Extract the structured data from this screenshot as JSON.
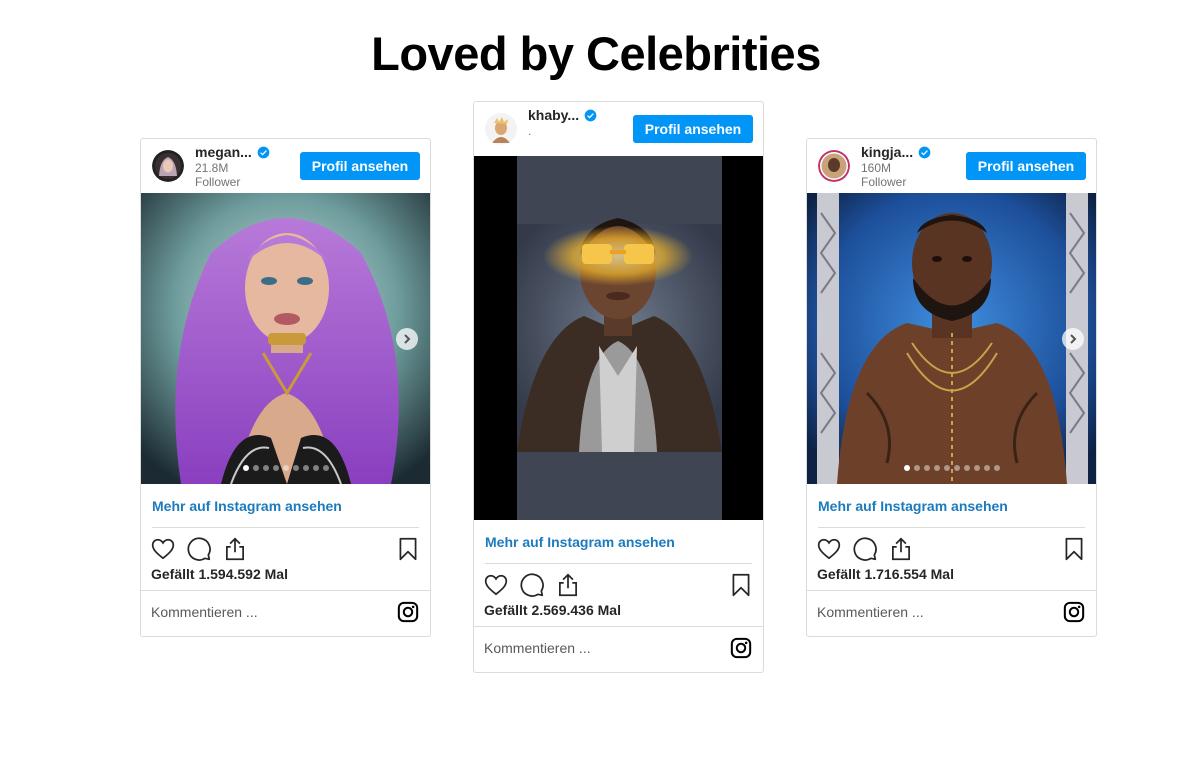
{
  "page": {
    "title": "Loved by Celebrities"
  },
  "posts": [
    {
      "username": "megan...",
      "followers": "21.8M",
      "followers_label": "Follower",
      "profile_button": "Profil ansehen",
      "more_link": "Mehr auf Instagram ansehen",
      "likes": "Gefällt 1.594.592 Mal",
      "comment_placeholder": "Kommentieren ...",
      "carousel_total": 9,
      "carousel_active": 1
    },
    {
      "username": "khaby...",
      "followers": ".",
      "profile_button": "Profil ansehen",
      "more_link": "Mehr auf Instagram ansehen",
      "likes": "Gefällt 2.569.436 Mal",
      "comment_placeholder": "Kommentieren ..."
    },
    {
      "username": "kingja...",
      "followers": "160M",
      "followers_label": "Follower",
      "profile_button": "Profil ansehen",
      "more_link": "Mehr auf Instagram ansehen",
      "likes": "Gefällt 1.716.554 Mal",
      "comment_placeholder": "Kommentieren ...",
      "carousel_total": 10,
      "carousel_active": 1
    }
  ],
  "icons": {
    "verified": "verified-badge-icon",
    "like": "heart-icon",
    "comment": "comment-bubble-icon",
    "share": "share-icon",
    "save": "bookmark-icon",
    "instagram": "instagram-logo-icon",
    "next": "chevron-right-icon"
  },
  "colors": {
    "button": "#0095f6",
    "link": "#1b7bbd",
    "border": "#dbdbdb"
  }
}
